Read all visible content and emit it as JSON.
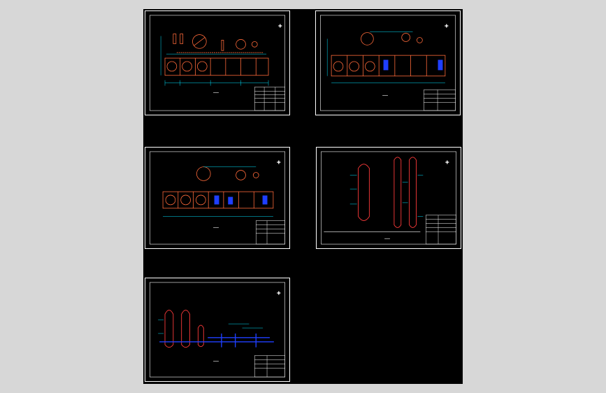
{
  "viewer": {
    "background_color": "#d7d7d7",
    "canvas_color": "#000000"
  },
  "drawing": {
    "line_colors": {
      "frame": "#ffffff",
      "equipment": "#ff3b3b",
      "dimension": "#00e5ff",
      "piping": "#1f3fff",
      "text": "#ffffff",
      "accent": "#ffff00"
    },
    "sheets": [
      {
        "id": "sheet-1",
        "view": "plan-view"
      },
      {
        "id": "sheet-2",
        "view": "plan-view"
      },
      {
        "id": "sheet-3",
        "view": "plan-view"
      },
      {
        "id": "sheet-4",
        "view": "vessel-elevation"
      },
      {
        "id": "sheet-5",
        "view": "piping-elevation"
      }
    ]
  }
}
